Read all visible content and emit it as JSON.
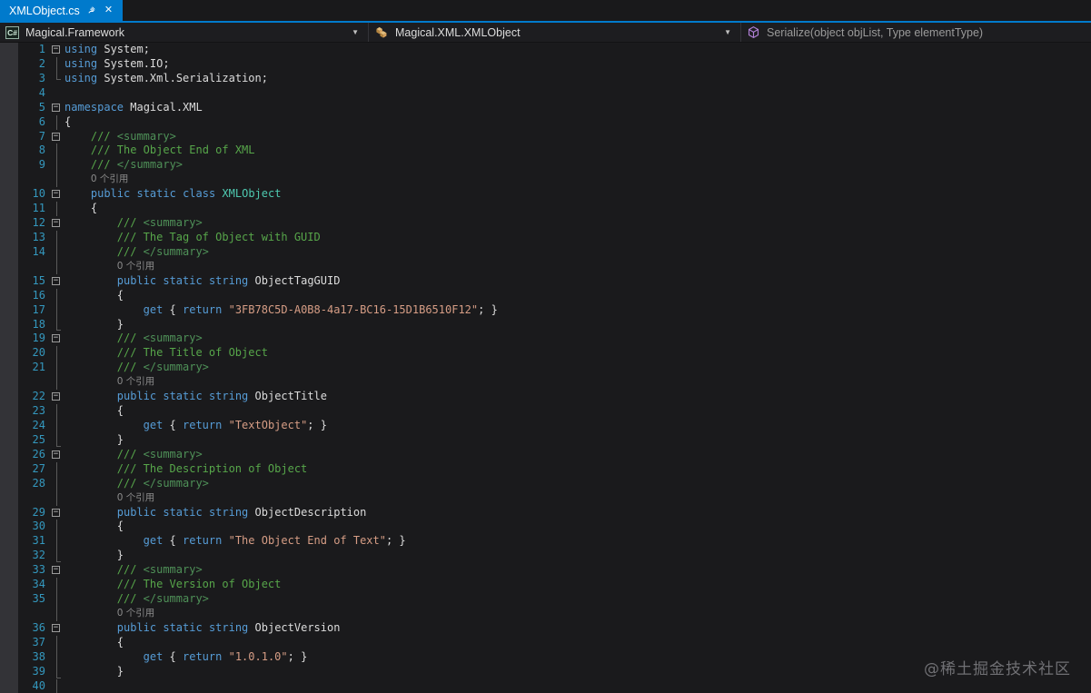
{
  "colors": {
    "accent": "#007acc",
    "editorBg": "#1a1a1c",
    "lnum": "#3498be",
    "keyword": "#569cd6",
    "type": "#4ec9b0",
    "string": "#d69d85",
    "comment": "#57a64a",
    "commentTag": "#4f9158",
    "plain": "#dcdcdc",
    "codelens": "#8c8c8c"
  },
  "tab_bar": {
    "tabs": [
      {
        "label": "XMLObject.cs",
        "active": true
      }
    ]
  },
  "nav_bar": {
    "project_dropdown": {
      "label": "Magical.Framework",
      "icon": "csharp-project-icon"
    },
    "type_dropdown": {
      "label": "Magical.XML.XMLObject",
      "icon": "class-icon"
    },
    "member_dropdown": {
      "label": "Serialize(object objList, Type elementType)",
      "icon": "method-icon"
    }
  },
  "editor": {
    "codelens_label": "0 个引用",
    "rows": [
      {
        "num": 1,
        "fold": "start",
        "ind": 0,
        "tokens": [
          [
            "k",
            "using"
          ],
          [
            "p",
            " System;"
          ]
        ]
      },
      {
        "num": 2,
        "fold": "line",
        "ind": 0,
        "tokens": [
          [
            "k",
            "using"
          ],
          [
            "p",
            " System.IO;"
          ]
        ]
      },
      {
        "num": 3,
        "fold": "end",
        "ind": 0,
        "tokens": [
          [
            "k",
            "using"
          ],
          [
            "p",
            " System.Xml.Serialization;"
          ]
        ]
      },
      {
        "num": 4,
        "fold": "none",
        "ind": 0,
        "tokens": []
      },
      {
        "num": 5,
        "fold": "start",
        "ind": 0,
        "tokens": [
          [
            "k",
            "namespace"
          ],
          [
            "p",
            " Magical.XML"
          ]
        ]
      },
      {
        "num": 6,
        "fold": "line",
        "ind": 0,
        "tokens": [
          [
            "p",
            "{"
          ]
        ]
      },
      {
        "num": 7,
        "fold": "start",
        "ind": 4,
        "tokens": [
          [
            "c",
            "/// "
          ],
          [
            "ct",
            "<summary>"
          ]
        ]
      },
      {
        "num": 8,
        "fold": "line",
        "ind": 4,
        "tokens": [
          [
            "c",
            "/// The Object End of XML"
          ]
        ]
      },
      {
        "num": 9,
        "fold": "line",
        "ind": 4,
        "tokens": [
          [
            "c",
            "/// "
          ],
          [
            "ct",
            "</summary>"
          ]
        ]
      },
      {
        "codelens": true,
        "fold": "line",
        "ind": 4
      },
      {
        "num": 10,
        "fold": "start",
        "ind": 4,
        "tokens": [
          [
            "k",
            "public"
          ],
          [
            "p",
            " "
          ],
          [
            "k",
            "static"
          ],
          [
            "p",
            " "
          ],
          [
            "k",
            "class"
          ],
          [
            "p",
            " "
          ],
          [
            "t",
            "XMLObject"
          ]
        ]
      },
      {
        "num": 11,
        "fold": "line",
        "ind": 4,
        "tokens": [
          [
            "p",
            "{"
          ]
        ]
      },
      {
        "num": 12,
        "fold": "start",
        "ind": 8,
        "tokens": [
          [
            "c",
            "/// "
          ],
          [
            "ct",
            "<summary>"
          ]
        ]
      },
      {
        "num": 13,
        "fold": "line",
        "ind": 8,
        "tokens": [
          [
            "c",
            "/// The Tag of Object with GUID"
          ]
        ]
      },
      {
        "num": 14,
        "fold": "line",
        "ind": 8,
        "tokens": [
          [
            "c",
            "/// "
          ],
          [
            "ct",
            "</summary>"
          ]
        ]
      },
      {
        "codelens": true,
        "fold": "line",
        "ind": 8
      },
      {
        "num": 15,
        "fold": "start",
        "ind": 8,
        "tokens": [
          [
            "k",
            "public"
          ],
          [
            "p",
            " "
          ],
          [
            "k",
            "static"
          ],
          [
            "p",
            " "
          ],
          [
            "k",
            "string"
          ],
          [
            "p",
            " ObjectTagGUID"
          ]
        ]
      },
      {
        "num": 16,
        "fold": "line",
        "ind": 8,
        "tokens": [
          [
            "p",
            "{"
          ]
        ]
      },
      {
        "num": 17,
        "fold": "line",
        "ind": 12,
        "tokens": [
          [
            "k",
            "get"
          ],
          [
            "p",
            " { "
          ],
          [
            "k",
            "return"
          ],
          [
            "p",
            " "
          ],
          [
            "s",
            "\"3FB78C5D-A0B8-4a17-BC16-15D1B6510F12\""
          ],
          [
            "p",
            "; }"
          ]
        ]
      },
      {
        "num": 18,
        "fold": "tick",
        "ind": 8,
        "tokens": [
          [
            "p",
            "}"
          ]
        ]
      },
      {
        "num": 19,
        "fold": "start",
        "ind": 8,
        "tokens": [
          [
            "c",
            "/// "
          ],
          [
            "ct",
            "<summary>"
          ]
        ]
      },
      {
        "num": 20,
        "fold": "line",
        "ind": 8,
        "tokens": [
          [
            "c",
            "/// The Title of Object"
          ]
        ]
      },
      {
        "num": 21,
        "fold": "line",
        "ind": 8,
        "tokens": [
          [
            "c",
            "/// "
          ],
          [
            "ct",
            "</summary>"
          ]
        ]
      },
      {
        "codelens": true,
        "fold": "line",
        "ind": 8
      },
      {
        "num": 22,
        "fold": "start",
        "ind": 8,
        "tokens": [
          [
            "k",
            "public"
          ],
          [
            "p",
            " "
          ],
          [
            "k",
            "static"
          ],
          [
            "p",
            " "
          ],
          [
            "k",
            "string"
          ],
          [
            "p",
            " ObjectTitle"
          ]
        ]
      },
      {
        "num": 23,
        "fold": "line",
        "ind": 8,
        "tokens": [
          [
            "p",
            "{"
          ]
        ]
      },
      {
        "num": 24,
        "fold": "line",
        "ind": 12,
        "tokens": [
          [
            "k",
            "get"
          ],
          [
            "p",
            " { "
          ],
          [
            "k",
            "return"
          ],
          [
            "p",
            " "
          ],
          [
            "s",
            "\"TextObject\""
          ],
          [
            "p",
            "; }"
          ]
        ]
      },
      {
        "num": 25,
        "fold": "tick",
        "ind": 8,
        "tokens": [
          [
            "p",
            "}"
          ]
        ]
      },
      {
        "num": 26,
        "fold": "start",
        "ind": 8,
        "tokens": [
          [
            "c",
            "/// "
          ],
          [
            "ct",
            "<summary>"
          ]
        ]
      },
      {
        "num": 27,
        "fold": "line",
        "ind": 8,
        "tokens": [
          [
            "c",
            "/// The Description of Object"
          ]
        ]
      },
      {
        "num": 28,
        "fold": "line",
        "ind": 8,
        "tokens": [
          [
            "c",
            "/// "
          ],
          [
            "ct",
            "</summary>"
          ]
        ]
      },
      {
        "codelens": true,
        "fold": "line",
        "ind": 8
      },
      {
        "num": 29,
        "fold": "start",
        "ind": 8,
        "tokens": [
          [
            "k",
            "public"
          ],
          [
            "p",
            " "
          ],
          [
            "k",
            "static"
          ],
          [
            "p",
            " "
          ],
          [
            "k",
            "string"
          ],
          [
            "p",
            " ObjectDescription"
          ]
        ]
      },
      {
        "num": 30,
        "fold": "line",
        "ind": 8,
        "tokens": [
          [
            "p",
            "{"
          ]
        ]
      },
      {
        "num": 31,
        "fold": "line",
        "ind": 12,
        "tokens": [
          [
            "k",
            "get"
          ],
          [
            "p",
            " { "
          ],
          [
            "k",
            "return"
          ],
          [
            "p",
            " "
          ],
          [
            "s",
            "\"The Object End of Text\""
          ],
          [
            "p",
            "; }"
          ]
        ]
      },
      {
        "num": 32,
        "fold": "tick",
        "ind": 8,
        "tokens": [
          [
            "p",
            "}"
          ]
        ]
      },
      {
        "num": 33,
        "fold": "start",
        "ind": 8,
        "tokens": [
          [
            "c",
            "/// "
          ],
          [
            "ct",
            "<summary>"
          ]
        ]
      },
      {
        "num": 34,
        "fold": "line",
        "ind": 8,
        "tokens": [
          [
            "c",
            "/// The Version of Object"
          ]
        ]
      },
      {
        "num": 35,
        "fold": "line",
        "ind": 8,
        "tokens": [
          [
            "c",
            "/// "
          ],
          [
            "ct",
            "</summary>"
          ]
        ]
      },
      {
        "codelens": true,
        "fold": "line",
        "ind": 8
      },
      {
        "num": 36,
        "fold": "start",
        "ind": 8,
        "tokens": [
          [
            "k",
            "public"
          ],
          [
            "p",
            " "
          ],
          [
            "k",
            "static"
          ],
          [
            "p",
            " "
          ],
          [
            "k",
            "string"
          ],
          [
            "p",
            " ObjectVersion"
          ]
        ]
      },
      {
        "num": 37,
        "fold": "line",
        "ind": 8,
        "tokens": [
          [
            "p",
            "{"
          ]
        ]
      },
      {
        "num": 38,
        "fold": "line",
        "ind": 12,
        "tokens": [
          [
            "k",
            "get"
          ],
          [
            "p",
            " { "
          ],
          [
            "k",
            "return"
          ],
          [
            "p",
            " "
          ],
          [
            "s",
            "\"1.0.1.0\""
          ],
          [
            "p",
            "; }"
          ]
        ]
      },
      {
        "num": 39,
        "fold": "tick",
        "ind": 8,
        "tokens": [
          [
            "p",
            "}"
          ]
        ]
      },
      {
        "num": 40,
        "fold": "line",
        "ind": 4,
        "tokens": []
      }
    ]
  },
  "watermark": "@稀土掘金技术社区"
}
